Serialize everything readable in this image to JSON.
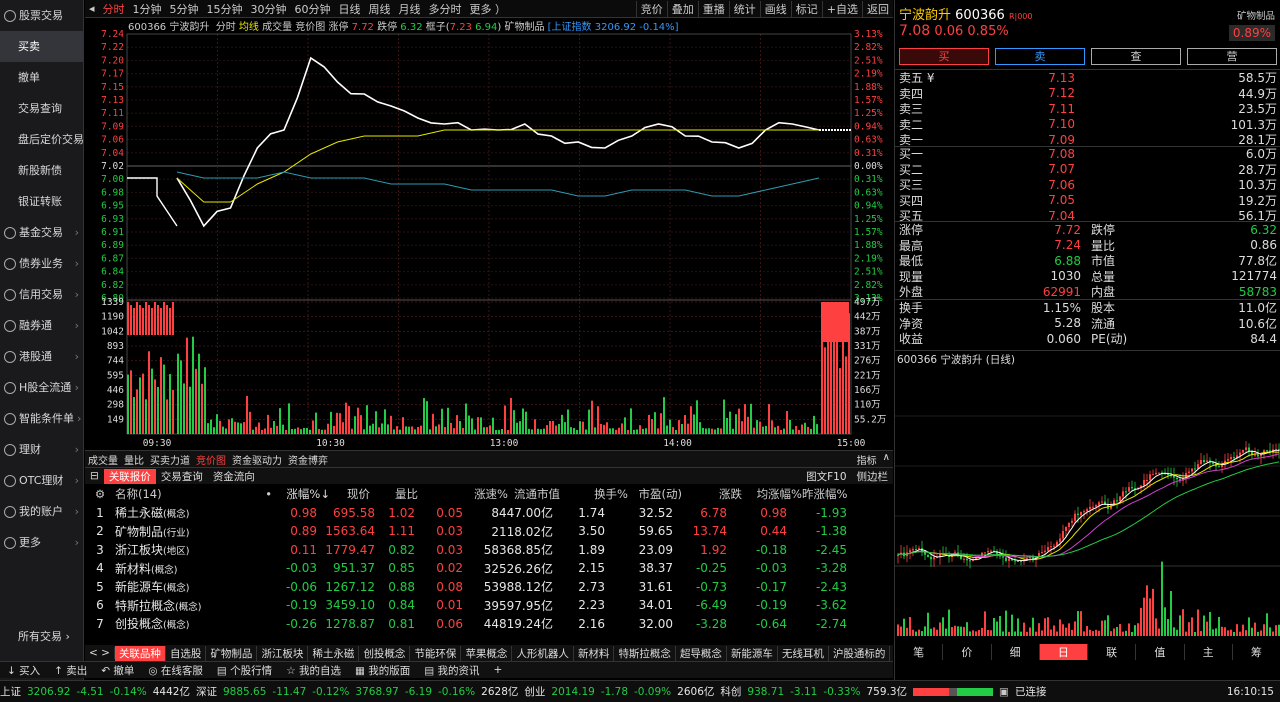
{
  "nav": {
    "items": [
      {
        "label": "股票交易",
        "group": true
      },
      {
        "label": "买卖",
        "sub": true,
        "active": true
      },
      {
        "label": "撤单",
        "sub": true
      },
      {
        "label": "交易查询",
        "sub": true
      },
      {
        "label": "盘后定价交易",
        "sub": true
      },
      {
        "label": "新股新债",
        "sub": true
      },
      {
        "label": "银证转账",
        "sub": true
      },
      {
        "label": "基金交易",
        "group": true
      },
      {
        "label": "债券业务",
        "group": true
      },
      {
        "label": "信用交易",
        "group": true
      },
      {
        "label": "融券通",
        "group": true
      },
      {
        "label": "港股通",
        "group": true
      },
      {
        "label": "H股全流通",
        "group": true
      },
      {
        "label": "智能条件单",
        "group": true
      },
      {
        "label": "理财",
        "group": true
      },
      {
        "label": "OTC理财",
        "group": true
      },
      {
        "label": "我的账户",
        "group": true
      },
      {
        "label": "更多",
        "group": true
      }
    ],
    "bottom": "所有交易 ›"
  },
  "toptabs": [
    "分时",
    "1分钟",
    "5分钟",
    "15分钟",
    "30分钟",
    "60分钟",
    "日线",
    "周线",
    "月线",
    "多分时",
    "更多 ）"
  ],
  "toptabs_right": [
    "竞价",
    "叠加",
    "重播",
    "统计",
    "画线",
    "标记",
    "+自选",
    "返回"
  ],
  "chartinfo": {
    "code": "600366 宁波韵升",
    "mode": "分时",
    "avg": "均线",
    "vol": "成交量",
    "auction": "竞价图",
    "zt_label": "涨停",
    "zt": "7.72",
    "dt_label": "跌停",
    "dt": "6.32",
    "box_label": "框子(",
    "box_hi": "7.23",
    "box_lo": "6.94",
    "box_end": ")",
    "sector": "矿物制品",
    "index": "[上证指数",
    "index_val": "3206.92",
    "index_pct": "-0.14%]"
  },
  "price_ticks": {
    "left": [
      "7.24",
      "7.22",
      "7.20",
      "7.17",
      "7.15",
      "7.13",
      "7.11",
      "7.09",
      "7.06",
      "7.04",
      "7.02",
      "7.00",
      "6.98",
      "6.95",
      "6.93",
      "6.91",
      "6.89",
      "6.87",
      "6.84",
      "6.82",
      "6.80"
    ],
    "right": [
      "3.13%",
      "2.82%",
      "2.51%",
      "2.19%",
      "1.88%",
      "1.57%",
      "1.25%",
      "0.94%",
      "0.63%",
      "0.31%",
      "0.00%",
      "0.31%",
      "0.63%",
      "0.94%",
      "1.25%",
      "1.57%",
      "1.88%",
      "2.19%",
      "2.51%",
      "2.82%",
      "3.13%"
    ]
  },
  "vol_ticks": {
    "left": [
      "1339",
      "1190",
      "1042",
      "893",
      "744",
      "595",
      "446",
      "298",
      "149"
    ],
    "right": [
      "497万",
      "442万",
      "387万",
      "331万",
      "276万",
      "221万",
      "166万",
      "110万",
      "55.2万"
    ]
  },
  "time_ticks": [
    "09:30",
    "10:30",
    "13:00",
    "14:00",
    "15:00"
  ],
  "chart_data": {
    "type": "line",
    "title": "600366 宁波韵升 分时",
    "prev_close": 7.02,
    "ylim": [
      6.8,
      7.24
    ],
    "x": [
      "09:30",
      "09:40",
      "09:50",
      "10:00",
      "10:10",
      "10:20",
      "10:30",
      "10:40",
      "10:50",
      "11:00",
      "11:10",
      "11:20",
      "11:30",
      "13:10",
      "13:20",
      "13:30",
      "13:40",
      "13:50",
      "14:00",
      "14:10",
      "14:20",
      "14:30",
      "14:40",
      "14:50",
      "15:00"
    ],
    "series": [
      {
        "name": "价格",
        "color": "#ffffff",
        "values": [
          7.0,
          6.92,
          6.95,
          7.05,
          7.08,
          7.2,
          7.16,
          7.14,
          7.12,
          7.1,
          7.09,
          7.08,
          7.08,
          7.09,
          7.07,
          7.06,
          7.05,
          7.07,
          7.09,
          7.07,
          7.06,
          7.05,
          7.08,
          7.09,
          7.08
        ]
      },
      {
        "name": "均价",
        "color": "#e6e600",
        "values": [
          7.0,
          6.96,
          6.96,
          6.99,
          7.01,
          7.04,
          7.06,
          7.07,
          7.07,
          7.07,
          7.08,
          7.08,
          7.08,
          7.08,
          7.08,
          7.08,
          7.08,
          7.08,
          7.08,
          7.08,
          7.08,
          7.08,
          7.08,
          7.08,
          7.08
        ]
      },
      {
        "name": "上证指数",
        "color": "#2a9db0",
        "values": [
          7.01,
          7.0,
          7.0,
          7.0,
          7.01,
          7.0,
          7.0,
          7.0,
          6.99,
          6.99,
          6.99,
          6.98,
          6.98,
          6.98,
          6.98,
          6.97,
          6.97,
          6.98,
          6.98,
          6.98,
          6.97,
          6.97,
          6.98,
          6.99,
          7.0
        ]
      }
    ],
    "volume": {
      "ylim": [
        0,
        1339
      ],
      "open_vol": 1339,
      "close_vol": 1339
    }
  },
  "subtabs": [
    "成交量",
    "量比",
    "买卖力道",
    "竞价图",
    "资金驱动力",
    "资金博弈"
  ],
  "subtabs_sel": "竞价图",
  "subtabs_right": [
    "指标",
    "∧"
  ],
  "tabletabs": [
    "关联报价",
    "交易查询",
    "资金流向"
  ],
  "tabletabs_right": [
    "图文F10",
    "侧边栏"
  ],
  "table": {
    "headers": [
      "⚙",
      "名称(14)",
      "•",
      "涨幅%↓",
      "现价",
      "量比",
      "涨速%",
      "流通市值",
      "换手%",
      "市盈(动)",
      "涨跌",
      "均涨幅%",
      "昨涨幅%"
    ],
    "rows": [
      {
        "n": "1",
        "name": "稀土永磁",
        "tag": "(概念)",
        "zf": "0.98",
        "xj": "695.58",
        "lb": "1.02",
        "zs": "0.05",
        "ltsz": "8447.00亿",
        "hs": "1.74",
        "syl": "32.52",
        "zd": "6.78",
        "jzf": "0.98",
        "zzf": "-1.93"
      },
      {
        "n": "2",
        "name": "矿物制品",
        "tag": "(行业)",
        "zf": "0.89",
        "xj": "1563.64",
        "lb": "1.11",
        "zs": "0.03",
        "ltsz": "2118.02亿",
        "hs": "3.50",
        "syl": "59.65",
        "zd": "13.74",
        "jzf": "0.44",
        "zzf": "-1.38"
      },
      {
        "n": "3",
        "name": "浙江板块",
        "tag": "(地区)",
        "zf": "0.11",
        "xj": "1779.47",
        "lb": "0.82",
        "zs": "0.03",
        "ltsz": "58368.85亿",
        "hs": "1.89",
        "syl": "23.09",
        "zd": "1.92",
        "jzf": "-0.18",
        "zzf": "-2.45"
      },
      {
        "n": "4",
        "name": "新材料",
        "tag": "(概念)",
        "zf": "-0.03",
        "xj": "951.37",
        "lb": "0.85",
        "zs": "0.02",
        "ltsz": "32526.26亿",
        "hs": "2.15",
        "syl": "38.37",
        "zd": "-0.25",
        "jzf": "-0.03",
        "zzf": "-3.28"
      },
      {
        "n": "5",
        "name": "新能源车",
        "tag": "(概念)",
        "zf": "-0.06",
        "xj": "1267.12",
        "lb": "0.88",
        "zs": "0.08",
        "ltsz": "53988.12亿",
        "hs": "2.73",
        "syl": "31.61",
        "zd": "-0.73",
        "jzf": "-0.17",
        "zzf": "-2.43"
      },
      {
        "n": "6",
        "name": "特斯拉概念",
        "tag": "(概念)",
        "zf": "-0.19",
        "xj": "3459.10",
        "lb": "0.84",
        "zs": "0.01",
        "ltsz": "39597.95亿",
        "hs": "2.23",
        "syl": "34.01",
        "zd": "-6.49",
        "jzf": "-0.19",
        "zzf": "-3.62"
      },
      {
        "n": "7",
        "name": "创投概念",
        "tag": "(概念)",
        "zf": "-0.26",
        "xj": "1278.87",
        "lb": "0.81",
        "zs": "0.06",
        "ltsz": "44819.24亿",
        "hs": "2.16",
        "syl": "32.00",
        "zd": "-3.28",
        "jzf": "-0.64",
        "zzf": "-2.74"
      }
    ]
  },
  "sectors": [
    "< >",
    "关联品种",
    "自选股",
    "矿物制品",
    "浙江板块",
    "稀土永磁",
    "创投概念",
    "节能环保",
    "苹果概念",
    "人形机器人",
    "新材料",
    "特斯拉概念",
    "超导概念",
    "新能源车",
    "无线耳机",
    "沪股通标的",
    "融资融"
  ],
  "actions": [
    "↓ 买入",
    "↑ 卖出",
    "↶ 撤单",
    "◎ 在线客服",
    "▤ 个股行情",
    "☆ 我的自选",
    "▦ 我的版面",
    "▤ 我的资讯",
    "+"
  ],
  "status": {
    "sh": "上证",
    "sh_val": "3206.92",
    "sh_chg": "-4.51",
    "sh_pct": "-0.14%",
    "sh_amt": "4442亿",
    "sz": "深证",
    "sz_val": "9885.65",
    "sz_chg": "-11.47",
    "sz_pct": "-0.12%",
    "sz_amt": "3768.97",
    "sz2_chg": "-6.19",
    "sz2_pct": "-0.16%",
    "sz2_amt": "2628亿",
    "cy": "创业",
    "cy_val": "2014.19",
    "cy_chg": "-1.78",
    "cy_pct": "-0.09%",
    "cy_amt": "2606亿",
    "kc": "科创",
    "kc_val": "938.71",
    "kc_chg": "-3.11",
    "kc_pct": "-0.33%",
    "kc_amt": "759.3亿",
    "conn": "已连接",
    "time": "16:10:15"
  },
  "quote": {
    "name": "宁波韵升",
    "code": "600366",
    "tag": "R|000",
    "sector": "矿物制品",
    "price": "7.08",
    "chg": "0.06",
    "pct": "0.85%",
    "box_pct": "0.89%",
    "buttons": [
      "买",
      "卖",
      "查",
      "营"
    ],
    "asks": [
      {
        "l": "卖五 ¥",
        "p": "7.13",
        "v": "58.5万"
      },
      {
        "l": "卖四",
        "p": "7.12",
        "v": "44.9万"
      },
      {
        "l": "卖三",
        "p": "7.11",
        "v": "23.5万"
      },
      {
        "l": "卖二",
        "p": "7.10",
        "v": "101.3万"
      },
      {
        "l": "卖一",
        "p": "7.09",
        "v": "28.1万"
      }
    ],
    "bids": [
      {
        "l": "买一",
        "p": "7.08",
        "v": "6.0万"
      },
      {
        "l": "买二",
        "p": "7.07",
        "v": "28.7万"
      },
      {
        "l": "买三",
        "p": "7.06",
        "v": "10.3万"
      },
      {
        "l": "买四",
        "p": "7.05",
        "v": "19.2万"
      },
      {
        "l": "买五",
        "p": "7.04",
        "v": "56.1万"
      }
    ],
    "stats1": [
      [
        "涨停",
        "7.72",
        "跌停",
        "6.32"
      ],
      [
        "最高",
        "7.24",
        "量比",
        "0.86"
      ],
      [
        "最低",
        "6.88",
        "市值",
        "77.8亿"
      ],
      [
        "现量",
        "1030",
        "总量",
        "121774"
      ],
      [
        "外盘",
        "62991",
        "内盘",
        "58783"
      ]
    ],
    "stats2": [
      [
        "换手",
        "1.15%",
        "股本",
        "11.0亿"
      ],
      [
        "净资",
        "5.28",
        "流通",
        "10.6亿"
      ],
      [
        "收益",
        "0.060",
        "PE(动)",
        "84.4"
      ]
    ],
    "kline_title": "600366 宁波韵升 (日线)",
    "kline_tabs": [
      "笔",
      "价",
      "细",
      "日",
      "联",
      "值",
      "主",
      "筹"
    ],
    "kline_sel": "日"
  },
  "colors": {
    "up": "#ff4040",
    "down": "#22cc44",
    "price_line": "#ffffff",
    "avg_line": "#e6e600",
    "index_line": "#2a9db0"
  }
}
